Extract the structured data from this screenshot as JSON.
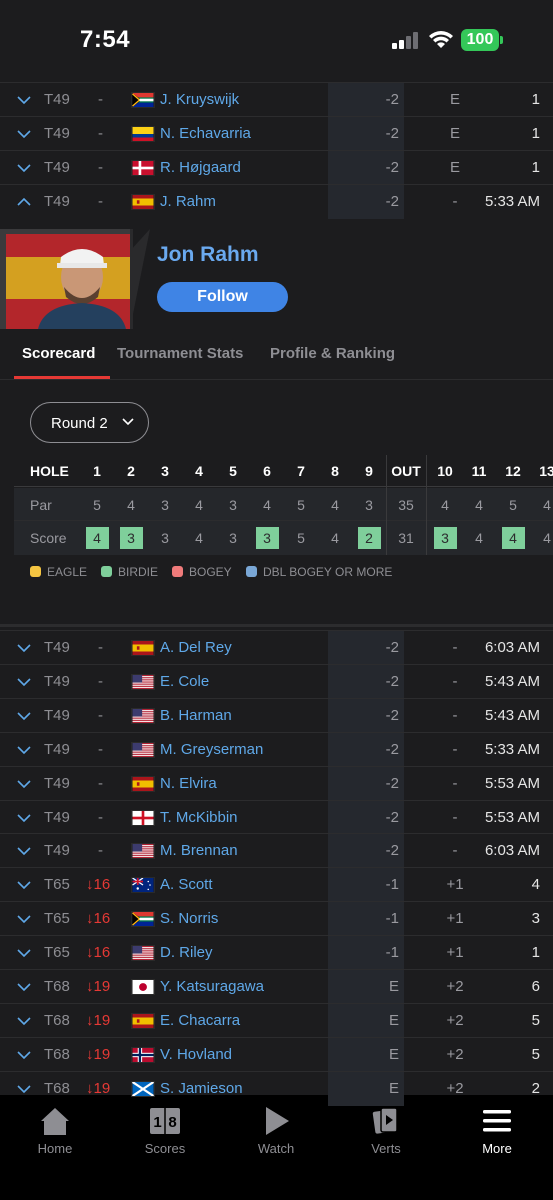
{
  "status_bar": {
    "time": "7:54",
    "battery": "100"
  },
  "rows_top": [
    {
      "pos": "T49",
      "move": "-",
      "name": "J. Kruyswijk",
      "flag": "za",
      "total": "-2",
      "thru": "E",
      "last": "1",
      "expanded": false
    },
    {
      "pos": "T49",
      "move": "-",
      "name": "N. Echavarria",
      "flag": "co",
      "total": "-2",
      "thru": "E",
      "last": "1",
      "expanded": false
    },
    {
      "pos": "T49",
      "move": "-",
      "name": "R. Højgaard",
      "flag": "dk",
      "total": "-2",
      "thru": "E",
      "last": "1",
      "expanded": false
    },
    {
      "pos": "T49",
      "move": "-",
      "name": "J. Rahm",
      "flag": "es",
      "total": "-2",
      "thru": "-",
      "last": "5:33 AM",
      "expanded": true
    }
  ],
  "player_card": {
    "name": "Jon Rahm",
    "follow_label": "Follow",
    "tabs": [
      "Scorecard",
      "Tournament Stats",
      "Profile & Ranking"
    ],
    "round_label": "Round 2",
    "scorecard": {
      "header_label": "HOLE",
      "par_label": "Par",
      "score_label": "Score",
      "holes": [
        "1",
        "2",
        "3",
        "4",
        "5",
        "6",
        "7",
        "8",
        "9",
        "OUT",
        "10",
        "11",
        "12",
        "13"
      ],
      "par": [
        "5",
        "4",
        "3",
        "4",
        "3",
        "4",
        "5",
        "4",
        "3",
        "35",
        "4",
        "4",
        "5",
        "4"
      ],
      "score": [
        "4",
        "3",
        "3",
        "4",
        "3",
        "3",
        "5",
        "4",
        "2",
        "31",
        "3",
        "4",
        "4",
        "4"
      ],
      "birdie_holes": [
        0,
        1,
        5,
        8,
        10,
        12
      ]
    },
    "legend": [
      {
        "label": "EAGLE",
        "color": "#f5c542"
      },
      {
        "label": "BIRDIE",
        "color": "#7fcf9b"
      },
      {
        "label": "BOGEY",
        "color": "#f07b7b"
      },
      {
        "label": "DBL BOGEY OR MORE",
        "color": "#7aa7d6"
      }
    ]
  },
  "rows_bottom": [
    {
      "pos": "T49",
      "move": "-",
      "name": "A. Del Rey",
      "flag": "es",
      "total": "-2",
      "thru": "-",
      "last": "6:03 AM"
    },
    {
      "pos": "T49",
      "move": "-",
      "name": "E. Cole",
      "flag": "us",
      "total": "-2",
      "thru": "-",
      "last": "5:43 AM"
    },
    {
      "pos": "T49",
      "move": "-",
      "name": "B. Harman",
      "flag": "us",
      "total": "-2",
      "thru": "-",
      "last": "5:43 AM"
    },
    {
      "pos": "T49",
      "move": "-",
      "name": "M. Greyserman",
      "flag": "us",
      "total": "-2",
      "thru": "-",
      "last": "5:33 AM"
    },
    {
      "pos": "T49",
      "move": "-",
      "name": "N. Elvira",
      "flag": "es",
      "total": "-2",
      "thru": "-",
      "last": "5:53 AM"
    },
    {
      "pos": "T49",
      "move": "-",
      "name": "T. McKibbin",
      "flag": "en",
      "total": "-2",
      "thru": "-",
      "last": "5:53 AM"
    },
    {
      "pos": "T49",
      "move": "-",
      "name": "M. Brennan",
      "flag": "us",
      "total": "-2",
      "thru": "-",
      "last": "6:03 AM"
    },
    {
      "pos": "T65",
      "move": "16",
      "name": "A. Scott",
      "flag": "au",
      "total": "-1",
      "thru": "+1",
      "last": "4"
    },
    {
      "pos": "T65",
      "move": "16",
      "name": "S. Norris",
      "flag": "za",
      "total": "-1",
      "thru": "+1",
      "last": "3"
    },
    {
      "pos": "T65",
      "move": "16",
      "name": "D. Riley",
      "flag": "us",
      "total": "-1",
      "thru": "+1",
      "last": "1"
    },
    {
      "pos": "T68",
      "move": "19",
      "name": "Y. Katsuragawa",
      "flag": "jp",
      "total": "E",
      "thru": "+2",
      "last": "6"
    },
    {
      "pos": "T68",
      "move": "19",
      "name": "E. Chacarra",
      "flag": "es",
      "total": "E",
      "thru": "+2",
      "last": "5"
    },
    {
      "pos": "T68",
      "move": "19",
      "name": "V. Hovland",
      "flag": "no",
      "total": "E",
      "thru": "+2",
      "last": "5"
    },
    {
      "pos": "T68",
      "move": "19",
      "name": "S. Jamieson",
      "flag": "sc",
      "total": "E",
      "thru": "+2",
      "last": "2"
    }
  ],
  "tab_bar": [
    {
      "label": "Home",
      "icon": "home-icon",
      "active": false
    },
    {
      "label": "Scores",
      "icon": "scores-icon",
      "active": false
    },
    {
      "label": "Watch",
      "icon": "play-icon",
      "active": false
    },
    {
      "label": "Verts",
      "icon": "verts-icon",
      "active": false
    },
    {
      "label": "More",
      "icon": "menu-icon",
      "active": true
    }
  ]
}
